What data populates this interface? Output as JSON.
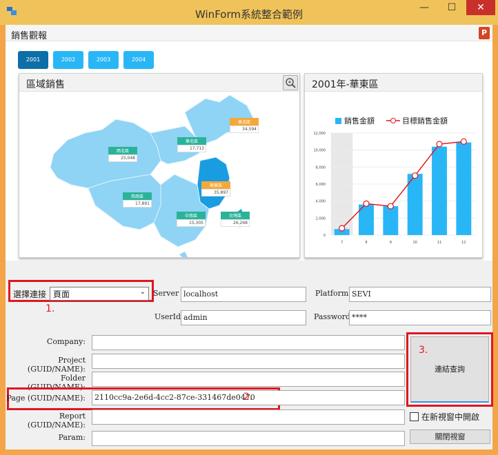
{
  "window": {
    "title": "WinForm系統整合範例",
    "minimize": "—",
    "maximize": "☐",
    "close": "✕"
  },
  "report": {
    "title": "銷售觀報",
    "years": [
      "2001",
      "2002",
      "2003",
      "2004"
    ],
    "active_year": "2001"
  },
  "map_panel": {
    "title": "區域銷售",
    "regions": [
      {
        "name": "東北區",
        "value": "34,594",
        "color": "#f4a83a"
      },
      {
        "name": "華北區",
        "value": "17,713",
        "color": "#2bb39a"
      },
      {
        "name": "西北區",
        "value": "25,048",
        "color": "#2bb39a"
      },
      {
        "name": "華東區",
        "value": "35,897",
        "color": "#f4a83a"
      },
      {
        "name": "西南區",
        "value": "17,891",
        "color": "#2bb39a"
      },
      {
        "name": "中南區",
        "value": "15,305",
        "color": "#2bb39a"
      },
      {
        "name": "台灣區",
        "value": "26,268",
        "color": "#2bb39a"
      }
    ]
  },
  "chart_panel": {
    "title": "2001年-華東區"
  },
  "chart_data": {
    "type": "bar",
    "categories": [
      "7",
      "8",
      "9",
      "10",
      "11",
      "12"
    ],
    "series": [
      {
        "name": "銷售金額",
        "type": "bar",
        "values": [
          700,
          3600,
          3400,
          7200,
          10400,
          10900
        ],
        "color": "#29b6f6"
      },
      {
        "name": "目標銷售金額",
        "type": "line",
        "values": [
          800,
          3700,
          3400,
          7000,
          10700,
          11000
        ],
        "color": "#e0161e"
      }
    ],
    "yticks": [
      "0",
      "2,000",
      "4,000",
      "6,000",
      "8,000",
      "10,000",
      "12,000"
    ],
    "ylim": [
      0,
      12000
    ],
    "highlighted_category": "7"
  },
  "form": {
    "connect_label": "選擇連接",
    "connect_value": "頁面",
    "server_label": "Server",
    "server_value": "localhost",
    "platform_label": "Platform",
    "platform_value": "SEVI",
    "userid_label": "UserId",
    "userid_value": "admin",
    "password_label": "Password",
    "password_value": "****",
    "company_label": "Company:",
    "project_label": "Project (GUID/NAME):",
    "folder_label": "Folder (GUID/NAME):",
    "page_label": "Page (GUID/NAME):",
    "page_value": "2110cc9a-2e6d-4cc2-87ce-331467de0470",
    "report_label": "Report (GUID/NAME):",
    "param_label": "Param:",
    "connect_query_button": "連結查詢",
    "new_window_checkbox": "在新視窗中開啟",
    "close_window_button": "關閉視窗",
    "step1": "1.",
    "step2": "2.",
    "step3": "3."
  }
}
